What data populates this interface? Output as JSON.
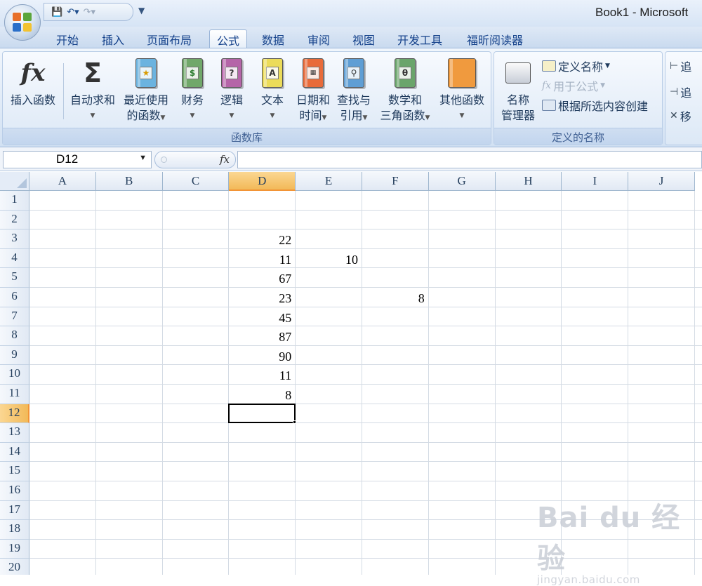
{
  "window": {
    "title": "Book1 - Microsoft"
  },
  "quick_access": {
    "save_icon": "save-icon",
    "undo_icon": "undo-icon",
    "redo_icon": "redo-icon"
  },
  "tabs": [
    {
      "label": "开始"
    },
    {
      "label": "插入"
    },
    {
      "label": "页面布局"
    },
    {
      "label": "公式",
      "active": true
    },
    {
      "label": "数据"
    },
    {
      "label": "审阅"
    },
    {
      "label": "视图"
    },
    {
      "label": "开发工具"
    },
    {
      "label": "福昕阅读器"
    }
  ],
  "ribbon": {
    "function_library": {
      "label": "函数库",
      "insert_function": "插入函数",
      "autosum": "自动求和",
      "recent_l1": "最近使用",
      "recent_l2": "的函数",
      "financial": "财务",
      "logical": "逻辑",
      "text": "文本",
      "datetime_l1": "日期和",
      "datetime_l2": "时间",
      "lookup_l1": "查找与",
      "lookup_l2": "引用",
      "math_l1": "数学和",
      "math_l2": "三角函数",
      "more": "其他函数"
    },
    "defined_names": {
      "label": "定义的名称",
      "name_manager_l1": "名称",
      "name_manager_l2": "管理器",
      "define_name": "定义名称",
      "use_in_formula": "用于公式",
      "create_from_selection": "根据所选内容创建"
    },
    "formula_auditing": {
      "trace_precedents": "追",
      "trace_dependents": "追",
      "remove_arrows": "移"
    }
  },
  "formula_bar": {
    "name_box": "D12",
    "fx": "fx",
    "formula": ""
  },
  "sheet": {
    "columns": [
      "A",
      "B",
      "C",
      "D",
      "E",
      "F",
      "G",
      "H",
      "I",
      "J"
    ],
    "rows": [
      "1",
      "2",
      "3",
      "4",
      "5",
      "6",
      "7",
      "8",
      "9",
      "10",
      "11",
      "12",
      "13",
      "14",
      "15",
      "16",
      "17",
      "18",
      "19",
      "20"
    ],
    "selected_cell": "D12",
    "cells": {
      "D3": "22",
      "D4": "11",
      "D5": "67",
      "D6": "23",
      "D7": "45",
      "D8": "87",
      "D9": "90",
      "D10": "11",
      "D11": "8",
      "E4": "10",
      "F6": "8"
    }
  },
  "watermark": {
    "brand": "Bai du 经验",
    "url": "jingyan.baidu.com"
  }
}
